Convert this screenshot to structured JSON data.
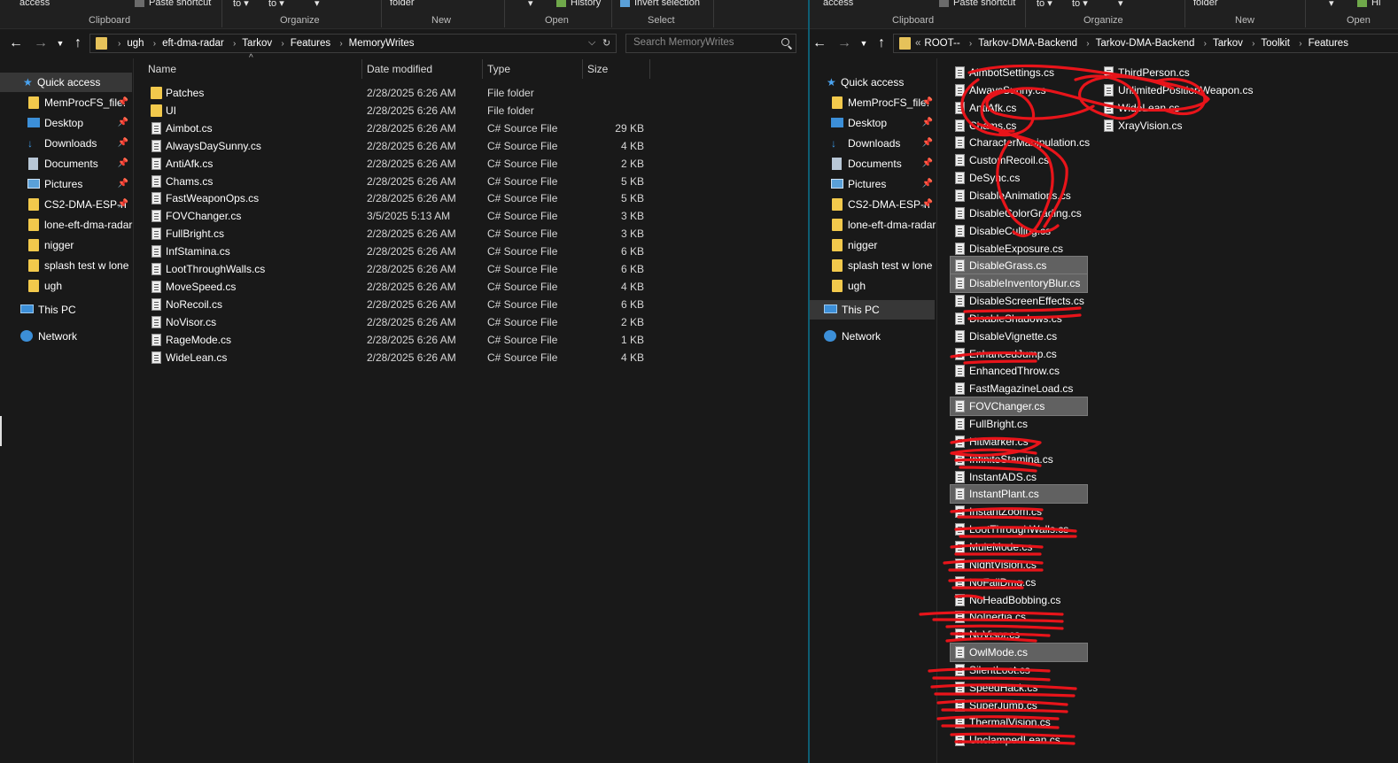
{
  "left": {
    "ribbon": {
      "top": [
        "access",
        "Paste shortcut",
        "to",
        "to",
        "folder",
        "History",
        "Invert selection"
      ],
      "captions": [
        "Clipboard",
        "Organize",
        "New",
        "Open",
        "Select"
      ]
    },
    "breadcrumb": [
      "ugh",
      "eft-dma-radar",
      "Tarkov",
      "Features",
      "MemoryWrites"
    ],
    "search_placeholder": "Search MemoryWrites",
    "nav": {
      "quick_access": "Quick access",
      "pinned": [
        "MemProcFS_file:",
        "Desktop",
        "Downloads",
        "Documents",
        "Pictures",
        "CS2-DMA-ESP-n"
      ],
      "folders": [
        "lone-eft-dma-radar",
        "nigger",
        "splash test w lone",
        "ugh"
      ],
      "this_pc": "This PC",
      "network": "Network"
    },
    "columns": {
      "name": "Name",
      "date": "Date modified",
      "type": "Type",
      "size": "Size"
    },
    "files": [
      {
        "name": "Patches",
        "date": "2/28/2025 6:26 AM",
        "type": "File folder",
        "size": "",
        "kind": "folder"
      },
      {
        "name": "UI",
        "date": "2/28/2025 6:26 AM",
        "type": "File folder",
        "size": "",
        "kind": "folder"
      },
      {
        "name": "Aimbot.cs",
        "date": "2/28/2025 6:26 AM",
        "type": "C# Source File",
        "size": "29 KB",
        "kind": "file"
      },
      {
        "name": "AlwaysDaySunny.cs",
        "date": "2/28/2025 6:26 AM",
        "type": "C# Source File",
        "size": "4 KB",
        "kind": "file"
      },
      {
        "name": "AntiAfk.cs",
        "date": "2/28/2025 6:26 AM",
        "type": "C# Source File",
        "size": "2 KB",
        "kind": "file"
      },
      {
        "name": "Chams.cs",
        "date": "2/28/2025 6:26 AM",
        "type": "C# Source File",
        "size": "5 KB",
        "kind": "file"
      },
      {
        "name": "FastWeaponOps.cs",
        "date": "2/28/2025 6:26 AM",
        "type": "C# Source File",
        "size": "5 KB",
        "kind": "file"
      },
      {
        "name": "FOVChanger.cs",
        "date": "3/5/2025 5:13 AM",
        "type": "C# Source File",
        "size": "3 KB",
        "kind": "file"
      },
      {
        "name": "FullBright.cs",
        "date": "2/28/2025 6:26 AM",
        "type": "C# Source File",
        "size": "3 KB",
        "kind": "file"
      },
      {
        "name": "InfStamina.cs",
        "date": "2/28/2025 6:26 AM",
        "type": "C# Source File",
        "size": "6 KB",
        "kind": "file"
      },
      {
        "name": "LootThroughWalls.cs",
        "date": "2/28/2025 6:26 AM",
        "type": "C# Source File",
        "size": "6 KB",
        "kind": "file"
      },
      {
        "name": "MoveSpeed.cs",
        "date": "2/28/2025 6:26 AM",
        "type": "C# Source File",
        "size": "4 KB",
        "kind": "file"
      },
      {
        "name": "NoRecoil.cs",
        "date": "2/28/2025 6:26 AM",
        "type": "C# Source File",
        "size": "6 KB",
        "kind": "file"
      },
      {
        "name": "NoVisor.cs",
        "date": "2/28/2025 6:26 AM",
        "type": "C# Source File",
        "size": "2 KB",
        "kind": "file"
      },
      {
        "name": "RageMode.cs",
        "date": "2/28/2025 6:26 AM",
        "type": "C# Source File",
        "size": "1 KB",
        "kind": "file"
      },
      {
        "name": "WideLean.cs",
        "date": "2/28/2025 6:26 AM",
        "type": "C# Source File",
        "size": "4 KB",
        "kind": "file"
      }
    ]
  },
  "right": {
    "ribbon": {
      "top": [
        "access",
        "Paste shortcut",
        "to",
        "to",
        "folder",
        "Hi"
      ],
      "captions": [
        "Clipboard",
        "Organize",
        "New",
        "Open"
      ]
    },
    "breadcrumb": [
      "ROOT--",
      "Tarkov-DMA-Backend",
      "Tarkov-DMA-Backend",
      "Tarkov",
      "Toolkit",
      "Features"
    ],
    "breadcrumb_overflow": "«",
    "nav": {
      "quick_access": "Quick access",
      "pinned": [
        "MemProcFS_file:",
        "Desktop",
        "Downloads",
        "Documents",
        "Pictures",
        "CS2-DMA-ESP-n"
      ],
      "folders": [
        "lone-eft-dma-radar",
        "nigger",
        "splash test w lone",
        "ugh"
      ],
      "this_pc": "This PC",
      "network": "Network"
    },
    "col1": [
      {
        "name": "AimbotSettings.cs",
        "hl": false
      },
      {
        "name": "AlwaysSunny.cs",
        "hl": false
      },
      {
        "name": "AntiAfk.cs",
        "hl": false
      },
      {
        "name": "Chams.cs",
        "hl": false
      },
      {
        "name": "CharacterManipulation.cs",
        "hl": false
      },
      {
        "name": "CustomRecoil.cs",
        "hl": false
      },
      {
        "name": "DeSync.cs",
        "hl": false
      },
      {
        "name": "DisableAnimations.cs",
        "hl": false
      },
      {
        "name": "DisableColorGrading.cs",
        "hl": false
      },
      {
        "name": "DisableCulling.cs",
        "hl": false
      },
      {
        "name": "DisableExposure.cs",
        "hl": false
      },
      {
        "name": "DisableGrass.cs",
        "hl": true
      },
      {
        "name": "DisableInventoryBlur.cs",
        "hl": true
      },
      {
        "name": "DisableScreenEffects.cs",
        "hl": false
      },
      {
        "name": "DisableShadows.cs",
        "hl": false
      },
      {
        "name": "DisableVignette.cs",
        "hl": false
      },
      {
        "name": "EnhancedJump.cs",
        "hl": false
      },
      {
        "name": "EnhancedThrow.cs",
        "hl": false
      },
      {
        "name": "FastMagazineLoad.cs",
        "hl": false
      },
      {
        "name": "FOVChanger.cs",
        "hl": true
      },
      {
        "name": "FullBright.cs",
        "hl": false
      },
      {
        "name": "HitMarker.cs",
        "hl": false
      },
      {
        "name": "InfiniteStamina.cs",
        "hl": false
      },
      {
        "name": "InstantADS.cs",
        "hl": false
      },
      {
        "name": "InstantPlant.cs",
        "hl": true
      },
      {
        "name": "InstantZoom.cs",
        "hl": false
      },
      {
        "name": "LootThroughWalls.cs",
        "hl": false
      },
      {
        "name": "MuleMode.cs",
        "hl": false
      },
      {
        "name": "NightVision.cs",
        "hl": false
      },
      {
        "name": "NoFallDmg.cs",
        "hl": false
      },
      {
        "name": "NoHeadBobbing.cs",
        "hl": false
      },
      {
        "name": "NoInertia.cs",
        "hl": false
      },
      {
        "name": "NoVisor.cs",
        "hl": false
      },
      {
        "name": "OwlMode.cs",
        "hl": true
      },
      {
        "name": "SilentLoot.cs",
        "hl": false
      },
      {
        "name": "SpeedHack.cs",
        "hl": false
      },
      {
        "name": "SuperJump.cs",
        "hl": false
      },
      {
        "name": "ThermalVision.cs",
        "hl": false
      },
      {
        "name": "UnclampedLean.cs",
        "hl": false
      }
    ],
    "col2": [
      {
        "name": "ThirdPerson.cs"
      },
      {
        "name": "UnlimitedPositionWeapon.cs"
      },
      {
        "name": "WideLean.cs"
      },
      {
        "name": "XrayVision.cs"
      }
    ]
  }
}
